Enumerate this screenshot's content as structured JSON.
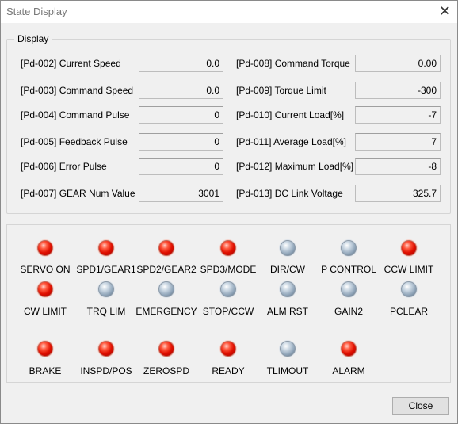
{
  "window": {
    "title": "State Display",
    "close_glyph": "✕"
  },
  "display": {
    "legend": "Display",
    "params": [
      {
        "label": "[Pd-002] Current Speed",
        "value": "0.0"
      },
      {
        "label": "[Pd-003] Command Speed",
        "value": "0.0"
      },
      {
        "label": "[Pd-004] Command Pulse",
        "value": "0"
      },
      {
        "label": "[Pd-005] Feedback Pulse",
        "value": "0"
      },
      {
        "label": "[Pd-006] Error Pulse",
        "value": "0"
      },
      {
        "label": "[Pd-007] GEAR Num Value",
        "value": "3001"
      },
      {
        "label": "[Pd-008] Command Torque",
        "value": "0.00"
      },
      {
        "label": "[Pd-009] Torque Limit",
        "value": "-300"
      },
      {
        "label": "[Pd-010] Current Load[%]",
        "value": "-7"
      },
      {
        "label": "[Pd-011] Average Load[%]",
        "value": "7"
      },
      {
        "label": "[Pd-012] Maximum Load[%]",
        "value": "-8"
      },
      {
        "label": "[Pd-013] DC Link Voltage",
        "value": "325.7"
      }
    ]
  },
  "indicators": [
    {
      "label": "SERVO ON",
      "state": "on"
    },
    {
      "label": "SPD1/GEAR1",
      "state": "on"
    },
    {
      "label": "SPD2/GEAR2",
      "state": "on"
    },
    {
      "label": "SPD3/MODE",
      "state": "on"
    },
    {
      "label": "DIR/CW",
      "state": "off"
    },
    {
      "label": "P CONTROL",
      "state": "off"
    },
    {
      "label": "CCW LIMIT",
      "state": "on"
    },
    {
      "label": "CW LIMIT",
      "state": "on"
    },
    {
      "label": "TRQ LIM",
      "state": "off"
    },
    {
      "label": "EMERGENCY",
      "state": "off"
    },
    {
      "label": "STOP/CCW",
      "state": "off"
    },
    {
      "label": "ALM RST",
      "state": "off"
    },
    {
      "label": "GAIN2",
      "state": "off"
    },
    {
      "label": "PCLEAR",
      "state": "off"
    },
    {
      "label": "BRAKE",
      "state": "on"
    },
    {
      "label": "INSPD/POS",
      "state": "on"
    },
    {
      "label": "ZEROSPD",
      "state": "on"
    },
    {
      "label": "READY",
      "state": "on"
    },
    {
      "label": "TLIMOUT",
      "state": "off"
    },
    {
      "label": "ALARM",
      "state": "on"
    }
  ],
  "footer": {
    "close_label": "Close"
  },
  "colors": {
    "led_on": "#e01000",
    "led_off": "#8ea3b7",
    "background": "#f0f0f0"
  }
}
